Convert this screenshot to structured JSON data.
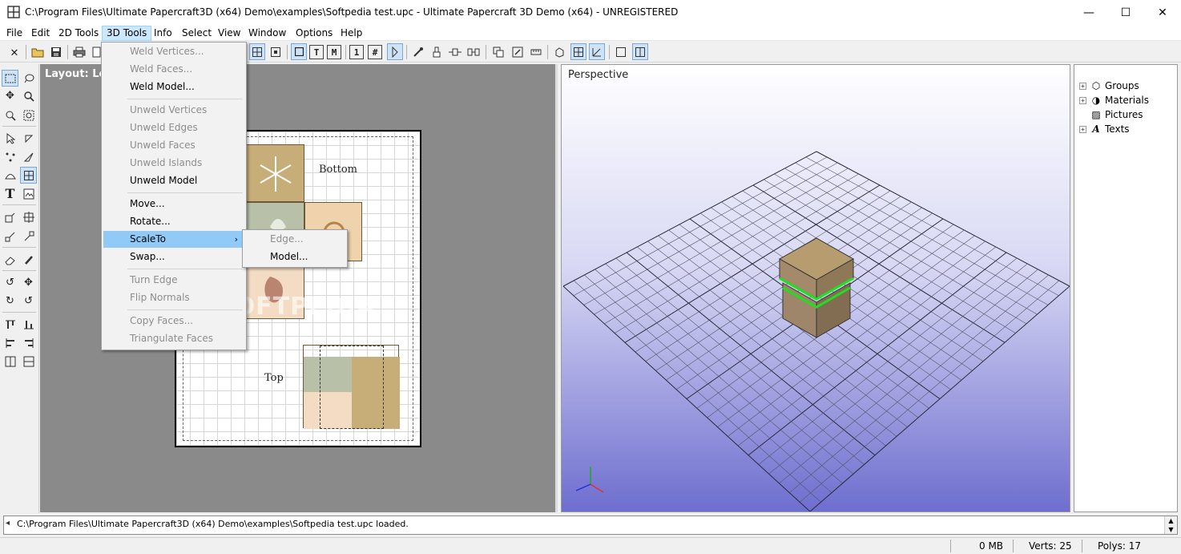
{
  "window": {
    "title": "C:\\Program Files\\Ultimate Papercraft3D (x64) Demo\\examples\\Softpedia test.upc - Ultimate Papercraft 3D Demo (x64) - UNREGISTERED",
    "minimize_glyph": "—",
    "maximize_glyph": "☐",
    "close_glyph": "✕"
  },
  "menu": {
    "file": "File",
    "edit": "Edit",
    "tools2d": "2D Tools",
    "tools3d": "3D Tools",
    "info": "Info",
    "select": "Select",
    "view": "View",
    "window": "Window",
    "options": "Options",
    "help": "Help"
  },
  "toolbar": {
    "icons": [
      "close-doc-icon",
      "open-folder-icon",
      "save-icon",
      "print-icon",
      "print-preview-icon"
    ],
    "view_buttons": [
      "T",
      "M",
      "1",
      "#"
    ]
  },
  "dropdown_3d_tools": {
    "weld_vertices": "Weld Vertices...",
    "weld_faces": "Weld Faces...",
    "weld_model": "Weld Model...",
    "unweld_vertices": "Unweld Vertices",
    "unweld_edges": "Unweld Edges",
    "unweld_faces": "Unweld Faces",
    "unweld_islands": "Unweld Islands",
    "unweld_model": "Unweld Model",
    "move": "Move...",
    "rotate": "Rotate...",
    "scale_to": "ScaleTo",
    "swap": "Swap...",
    "turn_edge": "Turn Edge",
    "flip_normals": "Flip Normals",
    "copy_faces": "Copy Faces...",
    "triangulate_faces": "Triangulate Faces"
  },
  "submenu_scale_to": {
    "edge": "Edge...",
    "model": "Model..."
  },
  "layout_view": {
    "label": "Layout: Let",
    "bottom_label": "Bottom",
    "top_label": "Top",
    "watermark": "SOFTPEDIA"
  },
  "perspective_view": {
    "label": "Perspective"
  },
  "tree": {
    "groups": "Groups",
    "materials": "Materials",
    "pictures": "Pictures",
    "texts": "Texts"
  },
  "log": {
    "message": "C:\\Program Files\\Ultimate Papercraft3D (x64) Demo\\examples\\Softpedia test.upc loaded."
  },
  "status": {
    "memory": "0 MB",
    "verts": "Verts: 25",
    "polys": "Polys: 17"
  },
  "colors": {
    "menu_highlight": "#91c9f7",
    "layout_bg": "#8a8a8a",
    "selection_green": "#1fe01f"
  }
}
